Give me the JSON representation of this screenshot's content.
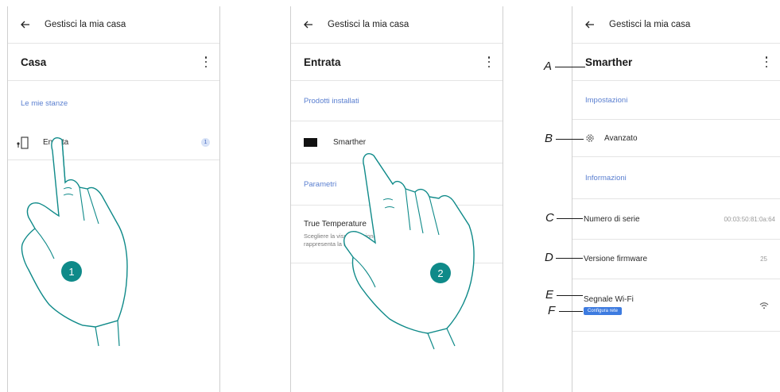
{
  "topbar_title": "Gestisci la mia casa",
  "step1": {
    "title": "Casa",
    "section": "Le mie stanze",
    "room_label": "Entrata",
    "room_count": "1",
    "step_number": "1"
  },
  "step2": {
    "title": "Entrata",
    "section_products": "Prodotti installati",
    "product_label": "Smarther",
    "section_params": "Parametri",
    "param_title": "True Temperature",
    "param_desc": "Scegliere la visualizzazione della temperatura che meglio rappresenta la temperatura della stanza",
    "step_number": "2"
  },
  "step3": {
    "title": "Smarther",
    "section_settings": "Impostazioni",
    "advanced_label": "Avanzato",
    "section_info": "Informazioni",
    "serial_label": "Numero di serie",
    "serial_value": "00:03:50:81:0a:64",
    "firmware_label": "Versione firmware",
    "firmware_value": "25",
    "wifi_label": "Segnale Wi-Fi",
    "configure_button": "Configura rete"
  },
  "annotations": {
    "A": "A",
    "B": "B",
    "C": "C",
    "D": "D",
    "E": "E",
    "F": "F"
  },
  "colors": {
    "accent": "#5a7fd0",
    "badge_bg": "#d7e2f7",
    "step_circle": "#0f8a89",
    "button": "#3d7be0",
    "hand_stroke": "#0f8a89"
  }
}
